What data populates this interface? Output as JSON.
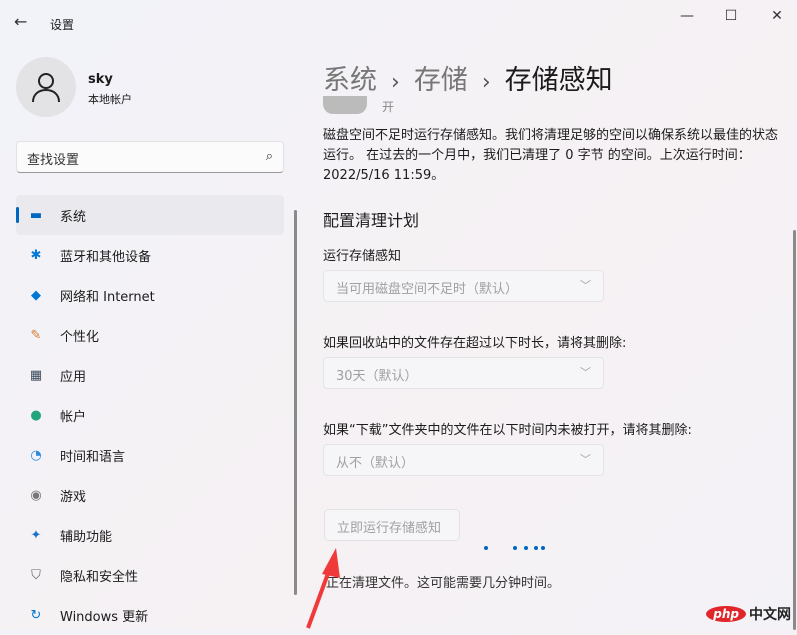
{
  "window": {
    "title": "设置",
    "minimize": "—",
    "maximize": "☐",
    "close": "✕"
  },
  "user": {
    "name": "sky",
    "type": "本地帐户"
  },
  "search": {
    "placeholder": "查找设置"
  },
  "nav": [
    {
      "label": "系统",
      "icon": "monitor-icon",
      "color": "#0067c0",
      "glyph": "▬"
    },
    {
      "label": "蓝牙和其他设备",
      "icon": "bluetooth-icon",
      "color": "#0078d4",
      "glyph": "✱"
    },
    {
      "label": "网络和 Internet",
      "icon": "wifi-icon",
      "color": "#0078d4",
      "glyph": "◆"
    },
    {
      "label": "个性化",
      "icon": "brush-icon",
      "color": "#d27b2c",
      "glyph": "✎"
    },
    {
      "label": "应用",
      "icon": "apps-icon",
      "color": "#3b4a5c",
      "glyph": "▦"
    },
    {
      "label": "帐户",
      "icon": "account-icon",
      "color": "#22a57a",
      "glyph": "●"
    },
    {
      "label": "时间和语言",
      "icon": "clock-globe-icon",
      "color": "#2b88d8",
      "glyph": "◔"
    },
    {
      "label": "游戏",
      "icon": "gamepad-icon",
      "color": "#777",
      "glyph": "◉"
    },
    {
      "label": "辅助功能",
      "icon": "accessibility-icon",
      "color": "#1a73c9",
      "glyph": "✦"
    },
    {
      "label": "隐私和安全性",
      "icon": "shield-icon",
      "color": "#666",
      "glyph": "⛉"
    },
    {
      "label": "Windows 更新",
      "icon": "update-icon",
      "color": "#0078d4",
      "glyph": "↻"
    }
  ],
  "breadcrumb": {
    "items": [
      "系统",
      "存储",
      "存储感知"
    ],
    "sep": "›"
  },
  "toggle": {
    "label": "开"
  },
  "description": "磁盘空间不足时运行存储感知。我们将清理足够的空间以确保系统以最佳的状态运行。 在过去的一个月中，我们已清理了 0 字节 的空间。上次运行时间：2022/5/16 11:59。",
  "section_title": "配置清理计划",
  "settings": [
    {
      "label": "运行存储感知",
      "value": "当可用磁盘空间不足时（默认）"
    },
    {
      "label": "如果回收站中的文件存在超过以下时长，请将其删除:",
      "value": "30天（默认）"
    },
    {
      "label": "如果“下载”文件夹中的文件在以下时间内未被打开，请将其删除:",
      "value": "从不（默认）"
    }
  ],
  "run_button": "立即运行存储感知",
  "status": "正在清理文件。这可能需要几分钟时间。",
  "watermark": {
    "logo": "php",
    "text": "中文网"
  }
}
